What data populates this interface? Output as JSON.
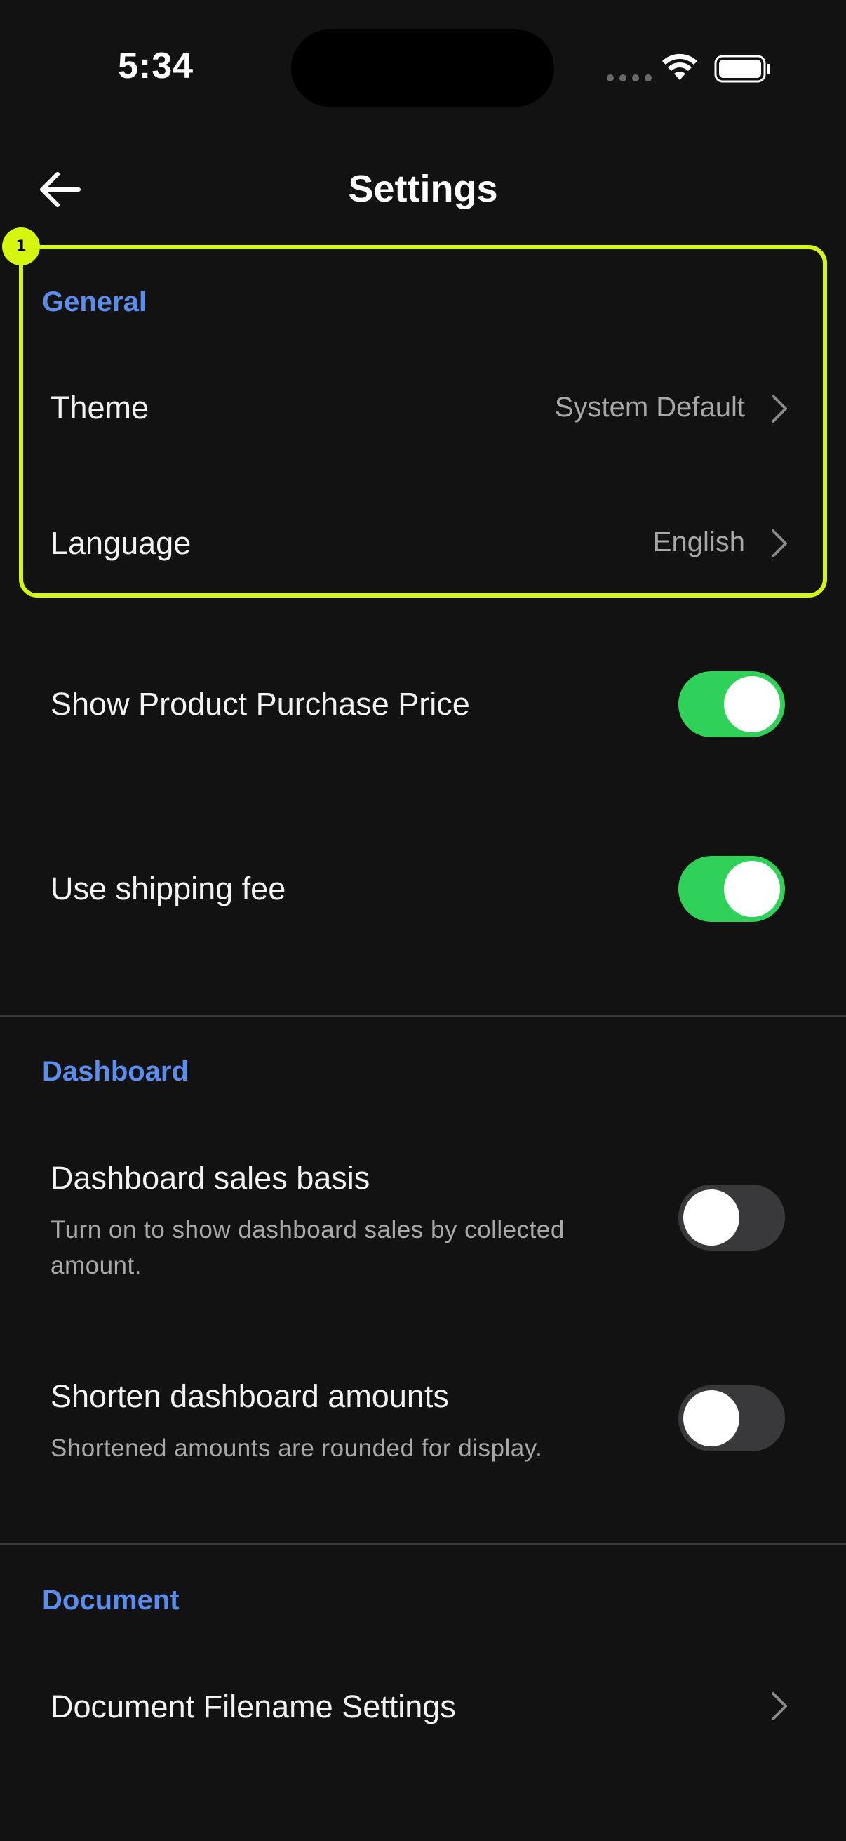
{
  "status_bar": {
    "time": "5:34"
  },
  "header": {
    "title": "Settings"
  },
  "highlight": {
    "badge": "1",
    "color": "#d6f50f"
  },
  "sections": {
    "general": {
      "title": "General",
      "theme": {
        "label": "Theme",
        "value": "System Default"
      },
      "language": {
        "label": "Language",
        "value": "English"
      },
      "purchase_price": {
        "label": "Show Product Purchase Price",
        "enabled": true
      },
      "shipping_fee": {
        "label": "Use shipping fee",
        "enabled": true
      }
    },
    "dashboard": {
      "title": "Dashboard",
      "sales_basis": {
        "label": "Dashboard sales basis",
        "desc_line1": "Turn on to show dashboard sales by collected",
        "desc_line2": "amount.",
        "enabled": false
      },
      "shorten": {
        "label": "Shorten dashboard amounts",
        "desc": "Shortened amounts are rounded for display.",
        "enabled": false
      }
    },
    "document": {
      "title": "Document",
      "filename": {
        "label": "Document Filename Settings"
      }
    }
  },
  "colors": {
    "background": "#121212",
    "section_title": "#5b8def",
    "toggle_on": "#2fd158",
    "toggle_off": "#39393b"
  }
}
